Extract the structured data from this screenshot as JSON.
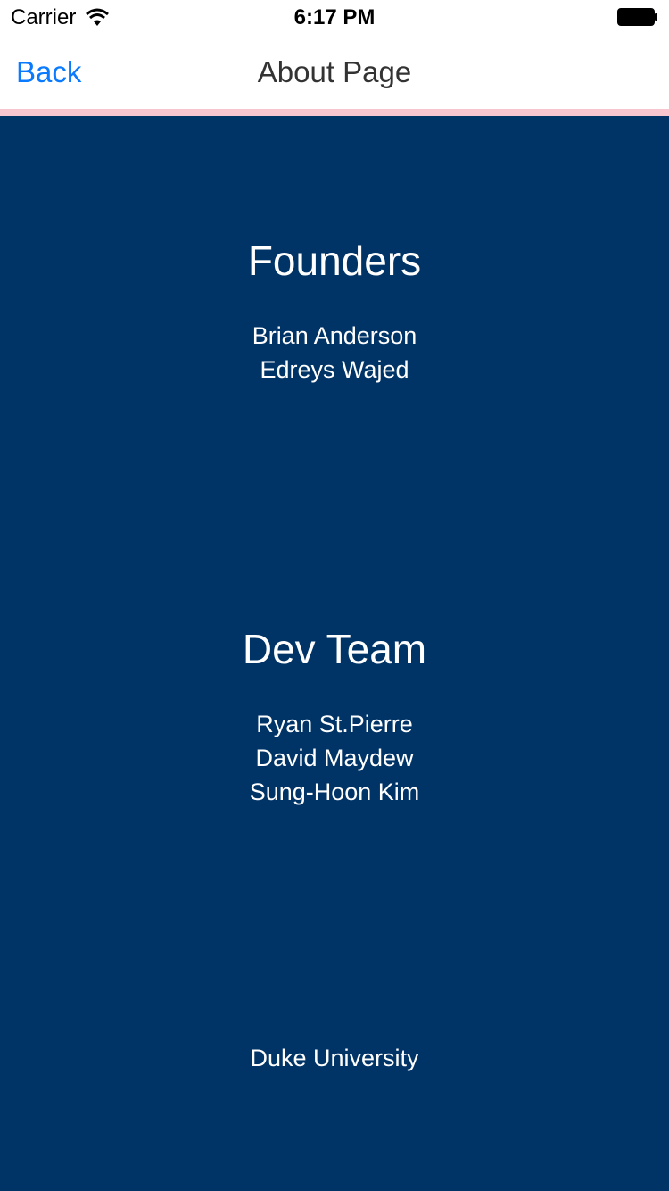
{
  "status_bar": {
    "carrier": "Carrier",
    "time": "6:17 PM",
    "wifi_icon": "wifi-icon",
    "battery_icon": "battery-icon"
  },
  "nav": {
    "back_label": "Back",
    "title": "About Page"
  },
  "colors": {
    "content_bg": "#003366",
    "accent_line": "#f7c6cf",
    "back_link": "#0a7aff"
  },
  "sections": {
    "founders": {
      "heading": "Founders",
      "names": [
        "Brian Anderson",
        "Edreys Wajed"
      ]
    },
    "dev_team": {
      "heading": "Dev Team",
      "names": [
        "Ryan St.Pierre",
        "David Maydew",
        "Sung-Hoon Kim"
      ]
    }
  },
  "footer": {
    "text": "Duke University"
  }
}
